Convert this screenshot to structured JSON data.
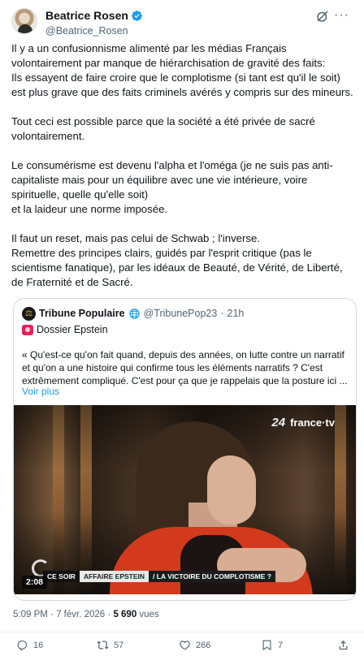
{
  "author": {
    "display_name": "Beatrice Rosen",
    "handle": "@Beatrice_Rosen",
    "verified": true
  },
  "tweet": {
    "paragraphs": [
      "Il y a un confusionnisme alimenté par les médias Français volontairement par manque de hiérarchisation de gravité des faits:\nIls essayent de faire croire que le complotisme (si tant est qu'il le soit) est plus grave que des faits criminels avérés y compris sur des mineurs.",
      "Tout ceci est possible parce que la société a été privée de sacré volontairement.",
      "Le consumérisme est devenu l'alpha et l'oméga (je ne suis pas anti-capitaliste mais pour un équilibre avec une vie intérieure, voire spirituelle, quelle qu'elle soit)\net la laideur une norme imposée.",
      "Il faut un reset, mais pas celui de Schwab ; l'inverse.\nRemettre des principes clairs, guidés par l'esprit critique (pas le scientisme fanatique), par les idéaux de Beauté, de Vérité, de Liberté, de Fraternité et de Sacré."
    ]
  },
  "quote": {
    "name": "Tribune Populaire",
    "handle": "@TribunePop23",
    "separator": "·",
    "time": "21h",
    "dossier": "Dossier Epstein",
    "text": "« Qu'est-ce qu'on fait quand, depuis des années, on lutte contre un narratif et qu'on a une histoire qui confirme tous les éléments narratifs ? C'est extrêmement compliqué. C'est pour ça que je rappelais que la posture ici ...",
    "read_more": "Voir plus",
    "video": {
      "channel_logo": "france·tv",
      "olympic_mark": "24",
      "lower_third": [
        "CE SOIR",
        "AFFAIRE EPSTEIN",
        "/ LA VICTOIRE DU COMPLOTISME ?"
      ],
      "duration": "2:08"
    }
  },
  "meta": {
    "time": "5:09 PM",
    "dot1": "·",
    "date": "7 févr. 2026",
    "dot2": "·",
    "views_count": "5 690",
    "views_label": "vues"
  },
  "actions": {
    "replies": "16",
    "reposts": "57",
    "likes": "266",
    "bookmarks": "7"
  },
  "colors": {
    "accent": "#1d9bf0",
    "text": "#0f1419",
    "muted": "#536471",
    "border": "#cfd9de"
  },
  "icons": [
    "verified-badge-icon",
    "grok-icon",
    "more-icon",
    "globe-icon",
    "siren-icon",
    "reply-icon",
    "repost-icon",
    "like-icon",
    "bookmark-icon",
    "share-icon"
  ]
}
